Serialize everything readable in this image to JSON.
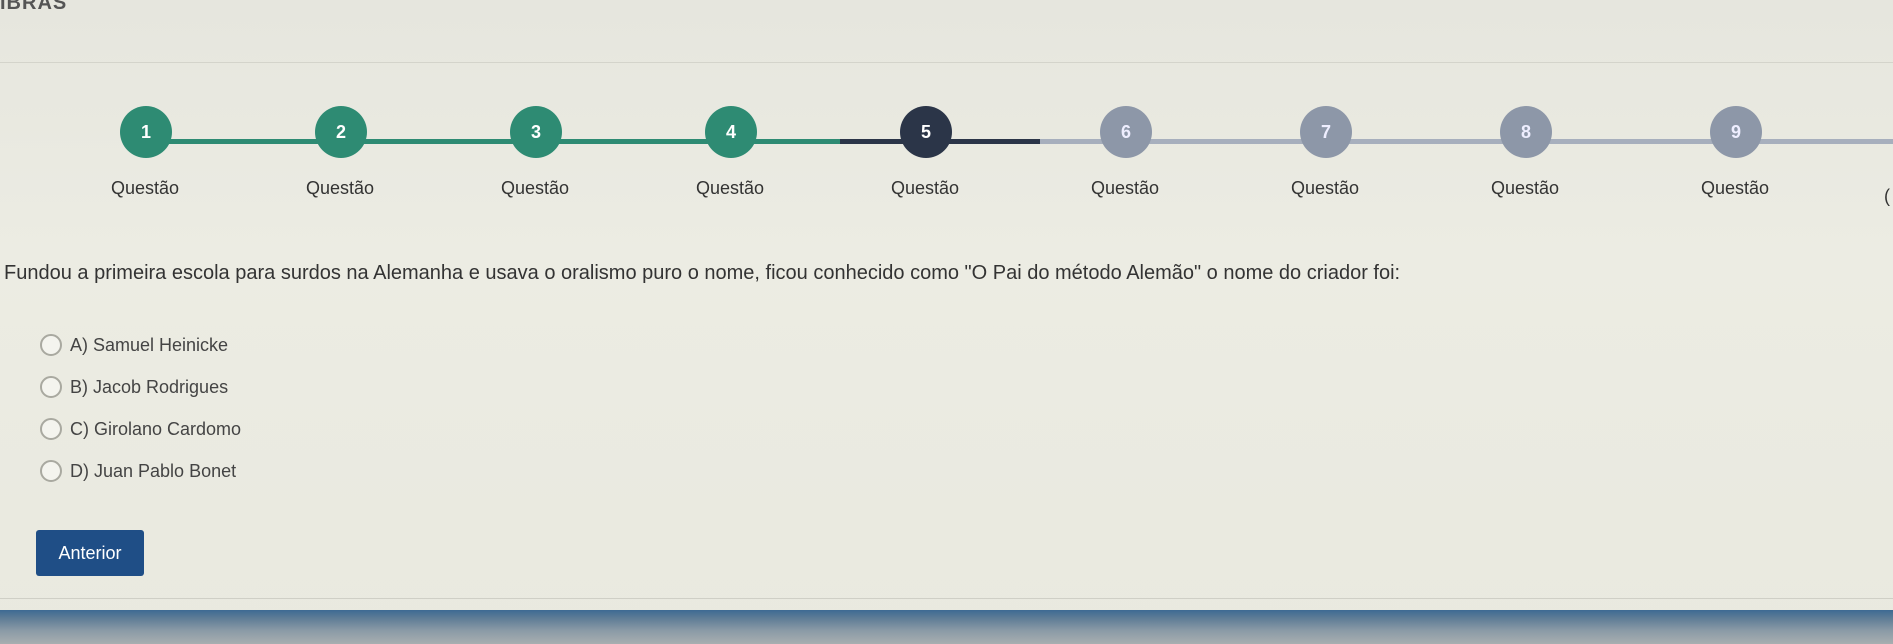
{
  "header": {
    "title": "IBRAS"
  },
  "stepper": {
    "steps": [
      {
        "number": "1",
        "label": "Questão",
        "state": "done"
      },
      {
        "number": "2",
        "label": "Questão",
        "state": "done"
      },
      {
        "number": "3",
        "label": "Questão",
        "state": "done"
      },
      {
        "number": "4",
        "label": "Questão",
        "state": "done"
      },
      {
        "number": "5",
        "label": "Questão",
        "state": "current"
      },
      {
        "number": "6",
        "label": "Questão",
        "state": "todo"
      },
      {
        "number": "7",
        "label": "Questão",
        "state": "todo"
      },
      {
        "number": "8",
        "label": "Questão",
        "state": "todo"
      },
      {
        "number": "9",
        "label": "Questão",
        "state": "todo"
      }
    ],
    "overflow_glyph": "(",
    "colors": {
      "done": "#2e8b73",
      "current": "#2b3548",
      "todo": "#8d97a8"
    }
  },
  "question": {
    "text": "Fundou a primeira escola para surdos na Alemanha e usava o oralismo puro o nome, ficou conhecido como \"O Pai do método Alemão\" o nome do criador foi:",
    "options": [
      {
        "label": "A) Samuel Heinicke",
        "selected": false
      },
      {
        "label": "B) Jacob Rodrigues",
        "selected": false
      },
      {
        "label": "C) Girolano Cardomo",
        "selected": false
      },
      {
        "label": "D) Juan Pablo Bonet",
        "selected": false
      }
    ]
  },
  "navigation": {
    "previous_label": "Anterior"
  }
}
